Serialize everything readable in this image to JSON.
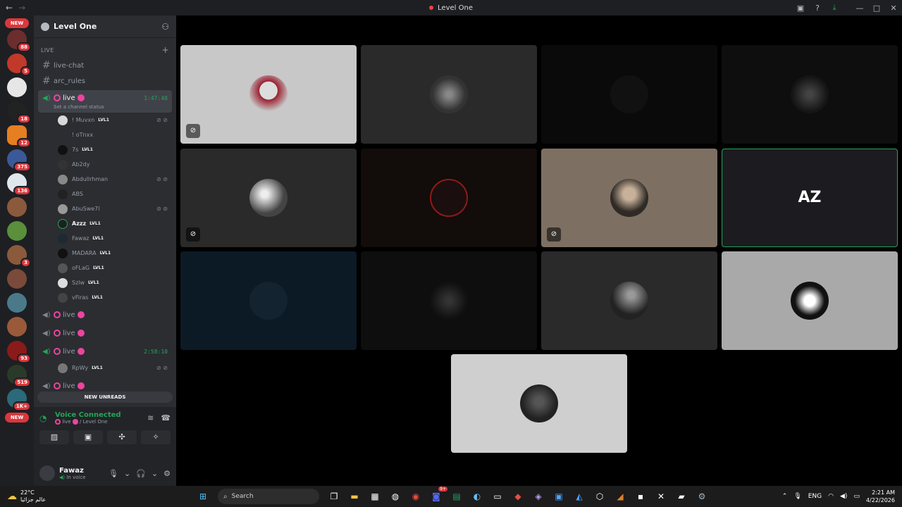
{
  "window": {
    "title": "Level One"
  },
  "servers": {
    "top_pill": "NEW",
    "bottom_pill": "NEW",
    "badges": [
      "88",
      "5",
      "18",
      "12",
      "375",
      "136",
      "3",
      "93",
      "519",
      "1K+"
    ]
  },
  "channels": {
    "guild_name": "Level One",
    "category": "LIVE",
    "text_channels": [
      "live-chat",
      "arc_rules"
    ],
    "active_voice": {
      "name": "live",
      "timer": "1:47:48",
      "status": "Set a channel status",
      "members": [
        {
          "name": "! Muvxn",
          "level": "LVL1",
          "muted": true
        },
        {
          "name": "! oTnxx",
          "level": "",
          "muted": false
        },
        {
          "name": "7s",
          "level": "LVL1",
          "muted": false
        },
        {
          "name": "Ab2dy",
          "level": "",
          "muted": false
        },
        {
          "name": "Abdullrhman",
          "level": "",
          "muted": true
        },
        {
          "name": "ABS",
          "level": "",
          "muted": false
        },
        {
          "name": "AbuSwe7l",
          "level": "",
          "muted": true
        },
        {
          "name": "Azzz",
          "level": "LVL1",
          "muted": false
        },
        {
          "name": "Fawaz",
          "level": "LVL1",
          "muted": false
        },
        {
          "name": "MADARA",
          "level": "LVL1",
          "muted": false
        },
        {
          "name": "oFLaG",
          "level": "LVL1",
          "muted": false
        },
        {
          "name": "Szlw",
          "level": "LVL1",
          "muted": false
        },
        {
          "name": "vFiras",
          "level": "LVL1",
          "muted": false
        }
      ]
    },
    "other_voice": [
      {
        "name": "live",
        "timer": ""
      },
      {
        "name": "live",
        "timer": ""
      },
      {
        "name": "live",
        "timer": "2:58:10"
      }
    ],
    "third_member": {
      "name": "RpWy",
      "level": "LVL1"
    },
    "last_voice": {
      "name": "live"
    },
    "new_unreads": "NEW UNREADS"
  },
  "voice_panel": {
    "title": "Voice Connected",
    "channel": "live",
    "server": "/ Level One"
  },
  "user": {
    "name": "Fawaz",
    "status": "In voice"
  },
  "taskbar": {
    "temperature": "22°C",
    "weather_text": "عالم جزائيا",
    "search_placeholder": "Search",
    "language": "ENG",
    "time": "2:21 AM",
    "date": "4/22/2026",
    "notification_badge": "9+"
  },
  "colors": {
    "accent_green": "#23a559",
    "live_pink": "#eb459e",
    "badge_red": "#da373c"
  }
}
